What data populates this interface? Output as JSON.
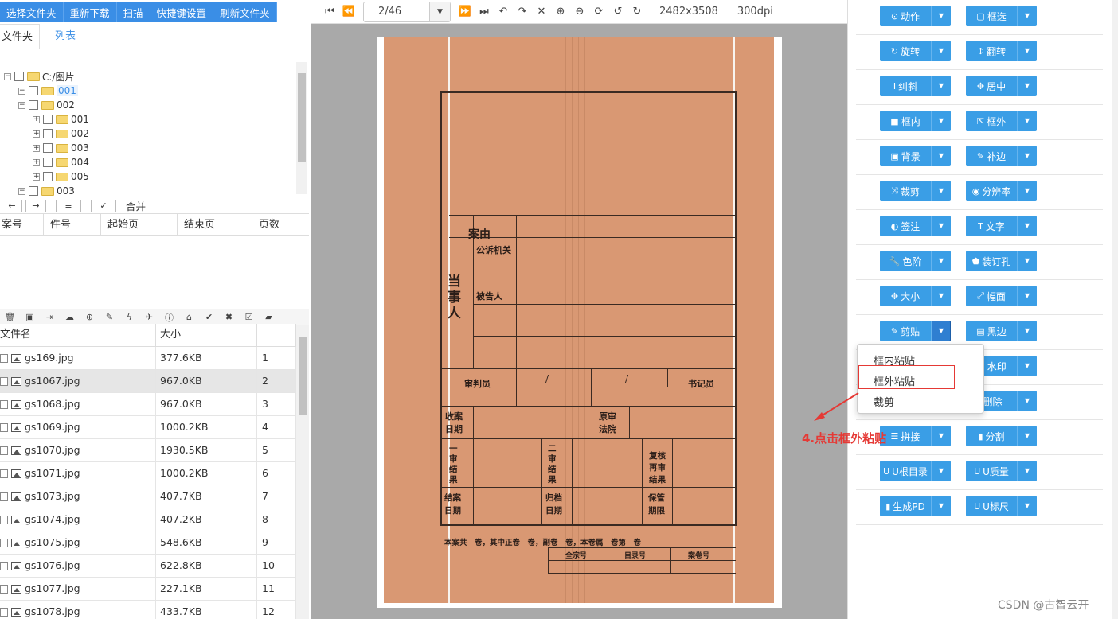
{
  "toolbar": {
    "buttons": [
      "选择文件夹",
      "重新下载",
      "扫描",
      "快捷键设置",
      "刷新文件夹"
    ]
  },
  "tabs": {
    "folder": "文件夹",
    "list": "列表"
  },
  "tree": [
    {
      "label": "C:/图片",
      "level": 0,
      "selected": false
    },
    {
      "label": "001",
      "level": 1,
      "selected": true
    },
    {
      "label": "002",
      "level": 1,
      "selected": false
    },
    {
      "label": "001",
      "level": 2,
      "selected": false
    },
    {
      "label": "002",
      "level": 2,
      "selected": false
    },
    {
      "label": "003",
      "level": 2,
      "selected": false
    },
    {
      "label": "004",
      "level": 2,
      "selected": false
    },
    {
      "label": "005",
      "level": 2,
      "selected": false
    },
    {
      "label": "003",
      "level": 1,
      "selected": false
    }
  ],
  "merge": {
    "label": "合并"
  },
  "columns1": [
    "案号",
    "件号",
    "起始页",
    "结束页",
    "页数"
  ],
  "columns2": {
    "name": "文件名",
    "size": "大小"
  },
  "files": [
    {
      "name": "gs169.jpg",
      "size": "377.6KB",
      "idx": "1"
    },
    {
      "name": "gs1067.jpg",
      "size": "967.0KB",
      "idx": "2"
    },
    {
      "name": "gs1068.jpg",
      "size": "967.0KB",
      "idx": "3"
    },
    {
      "name": "gs1069.jpg",
      "size": "1000.2KB",
      "idx": "4"
    },
    {
      "name": "gs1070.jpg",
      "size": "1930.5KB",
      "idx": "5"
    },
    {
      "name": "gs1071.jpg",
      "size": "1000.2KB",
      "idx": "6"
    },
    {
      "name": "gs1073.jpg",
      "size": "407.7KB",
      "idx": "7"
    },
    {
      "name": "gs1074.jpg",
      "size": "407.2KB",
      "idx": "8"
    },
    {
      "name": "gs1075.jpg",
      "size": "548.6KB",
      "idx": "9"
    },
    {
      "name": "gs1076.jpg",
      "size": "622.8KB",
      "idx": "10"
    },
    {
      "name": "gs1077.jpg",
      "size": "227.1KB",
      "idx": "11"
    },
    {
      "name": "gs1078.jpg",
      "size": "433.7KB",
      "idx": "12"
    }
  ],
  "viewer": {
    "page": "2/46",
    "dims": "2482x3508",
    "dpi": "300dpi"
  },
  "document": {
    "case": "案由",
    "prosecutor": "公诉机关",
    "defendant": "被告人",
    "party": "当事人",
    "judge": "审判员",
    "slash1": "/",
    "slash2": "/",
    "clerk": "书记员",
    "receive": "收案日期",
    "orig": "原审法院",
    "first": "一审结果",
    "second": "二审结果",
    "review": "复核再审结果",
    "close": "结案日期",
    "archive": "归档日期",
    "term": "保管期限",
    "footer": "本案共　卷，其中正卷　卷，副卷　卷，本卷属　卷第　卷",
    "quanzong": "全宗号",
    "mulu": "目录号",
    "anjuan": "案卷号"
  },
  "tools": [
    [
      "动作",
      "框选"
    ],
    [
      "旋转",
      "翻转"
    ],
    [
      "纠斜",
      "居中"
    ],
    [
      "框内",
      "框外"
    ],
    [
      "背景",
      "补边"
    ],
    [
      "裁剪",
      "分辨率"
    ],
    [
      "签注",
      "文字"
    ],
    [
      "色阶",
      "装订孔"
    ],
    [
      "大小",
      "幅面"
    ],
    [
      "剪贴",
      "黑边"
    ],
    [
      "",
      "水印"
    ],
    [
      "",
      "删除"
    ],
    [
      "拼接",
      "分割"
    ],
    [
      "U根目录",
      "U质量"
    ],
    [
      "生成PD",
      "U标尺"
    ]
  ],
  "menu": {
    "items": [
      "框内粘贴",
      "框外粘贴",
      "裁剪"
    ]
  },
  "annotation": "4.点击框外粘贴",
  "watermark": "CSDN @古智云开"
}
